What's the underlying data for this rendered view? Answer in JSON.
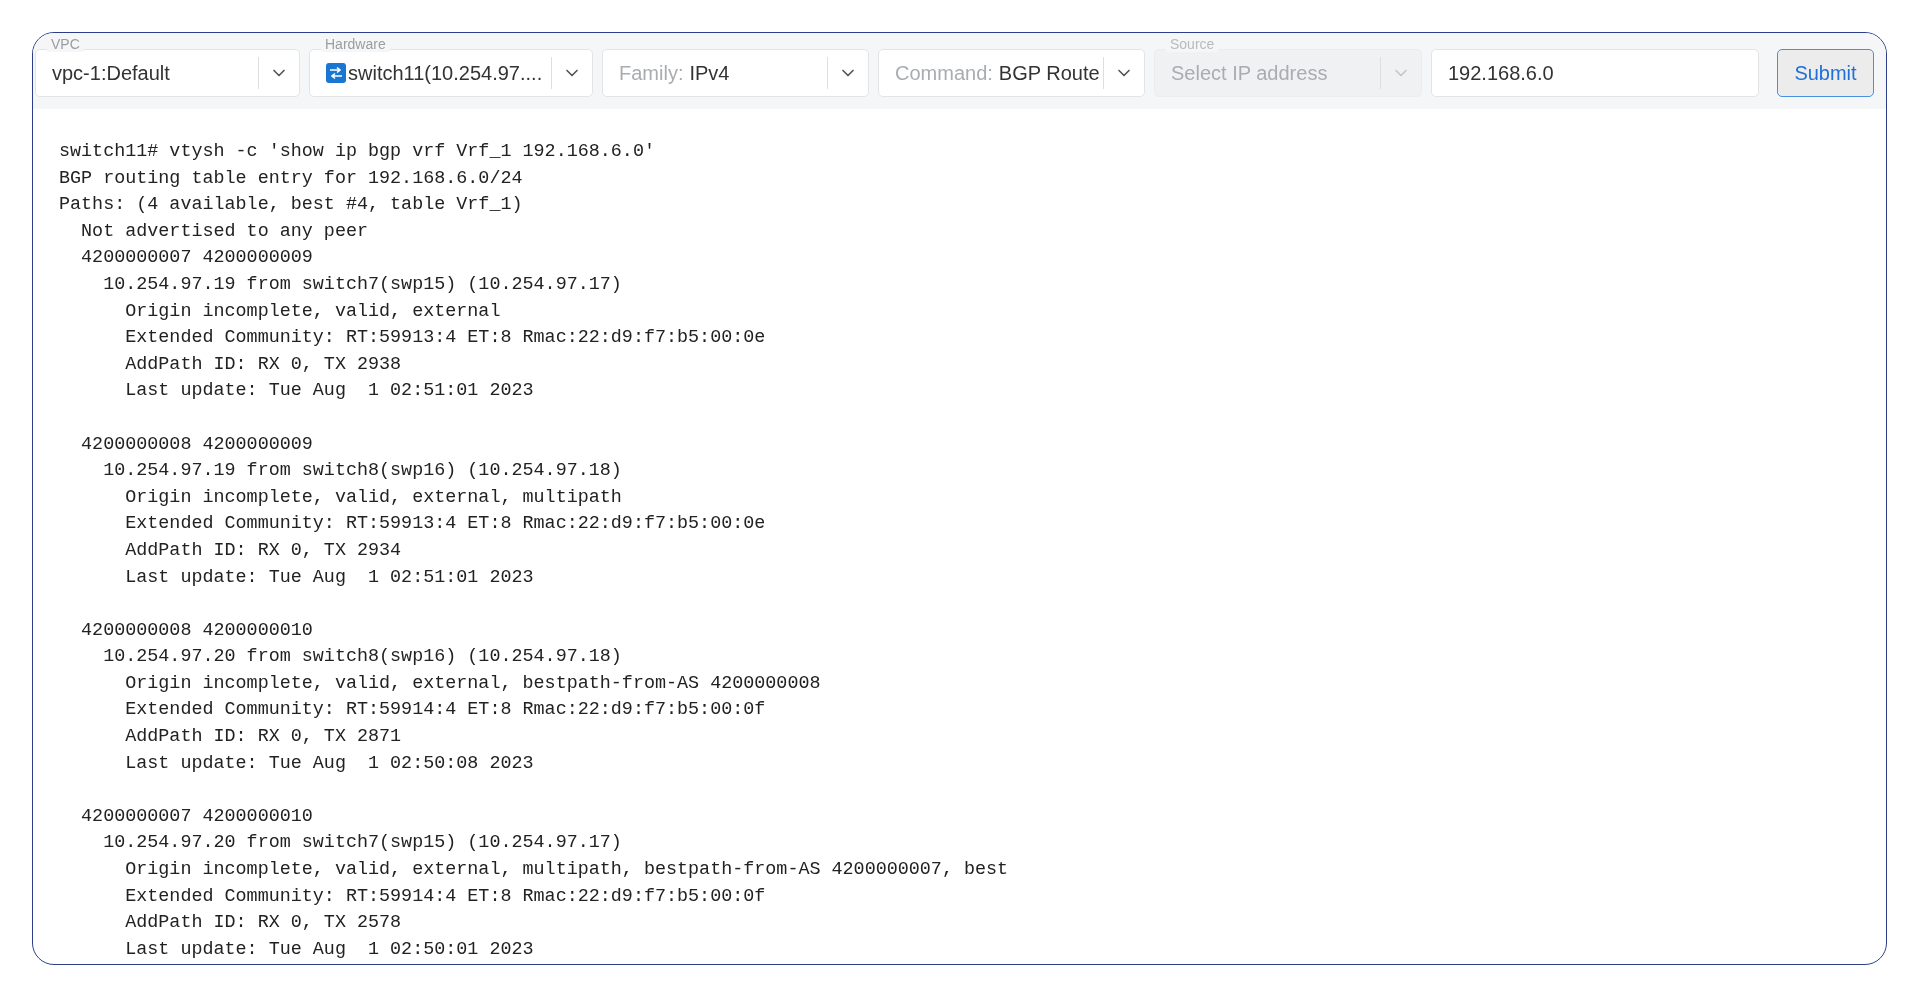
{
  "toolbar": {
    "fields": [
      {
        "kind": "select",
        "label": "VPC",
        "value": "vpc-1:Default",
        "disabled": false
      },
      {
        "kind": "device-select",
        "label": "Hardware",
        "value": "switch11(10.254.97....",
        "disabled": false
      },
      {
        "kind": "prefixed-select",
        "prefix": "Family:",
        "value": "IPv4",
        "disabled": false
      },
      {
        "kind": "prefixed-select",
        "prefix": "Command:",
        "value": "BGP Route",
        "disabled": false
      },
      {
        "kind": "select",
        "label": "Source",
        "placeholder": "Select IP address",
        "disabled": true
      },
      {
        "kind": "input",
        "value": "192.168.6.0",
        "disabled": false
      }
    ],
    "submit": "Submit"
  },
  "output": {
    "header": [
      "switch11# vtysh -c 'show ip bgp vrf Vrf_1 192.168.6.0'",
      "BGP routing table entry for 192.168.6.0/24",
      "Paths: (4 available, best #4, table Vrf_1)",
      "  Not advertised to any peer"
    ],
    "paths": [
      {
        "lines": [
          "  4200000007 4200000009",
          "    10.254.97.19 from switch7(swp15) (10.254.97.17)",
          "      Origin incomplete, valid, external",
          "      Extended Community: RT:59913:4 ET:8 Rmac:22:d9:f7:b5:00:0e",
          "      AddPath ID: RX 0, TX 2938",
          "      Last update: Tue Aug  1 02:51:01 2023"
        ]
      },
      {
        "lines": [
          "  4200000008 4200000009",
          "    10.254.97.19 from switch8(swp16) (10.254.97.18)",
          "      Origin incomplete, valid, external, multipath",
          "      Extended Community: RT:59913:4 ET:8 Rmac:22:d9:f7:b5:00:0e",
          "      AddPath ID: RX 0, TX 2934",
          "      Last update: Tue Aug  1 02:51:01 2023"
        ]
      },
      {
        "lines": [
          "  4200000008 4200000010",
          "    10.254.97.20 from switch8(swp16) (10.254.97.18)",
          "      Origin incomplete, valid, external, bestpath-from-AS 4200000008",
          "      Extended Community: RT:59914:4 ET:8 Rmac:22:d9:f7:b5:00:0f",
          "      AddPath ID: RX 0, TX 2871",
          "      Last update: Tue Aug  1 02:50:08 2023"
        ]
      },
      {
        "lines": [
          "  4200000007 4200000010",
          "    10.254.97.20 from switch7(swp15) (10.254.97.17)",
          "      Origin incomplete, valid, external, multipath, bestpath-from-AS 4200000007, best",
          "      Extended Community: RT:59914:4 ET:8 Rmac:22:d9:f7:b5:00:0f",
          "      AddPath ID: RX 0, TX 2578",
          "      Last update: Tue Aug  1 02:50:01 2023"
        ]
      }
    ]
  }
}
